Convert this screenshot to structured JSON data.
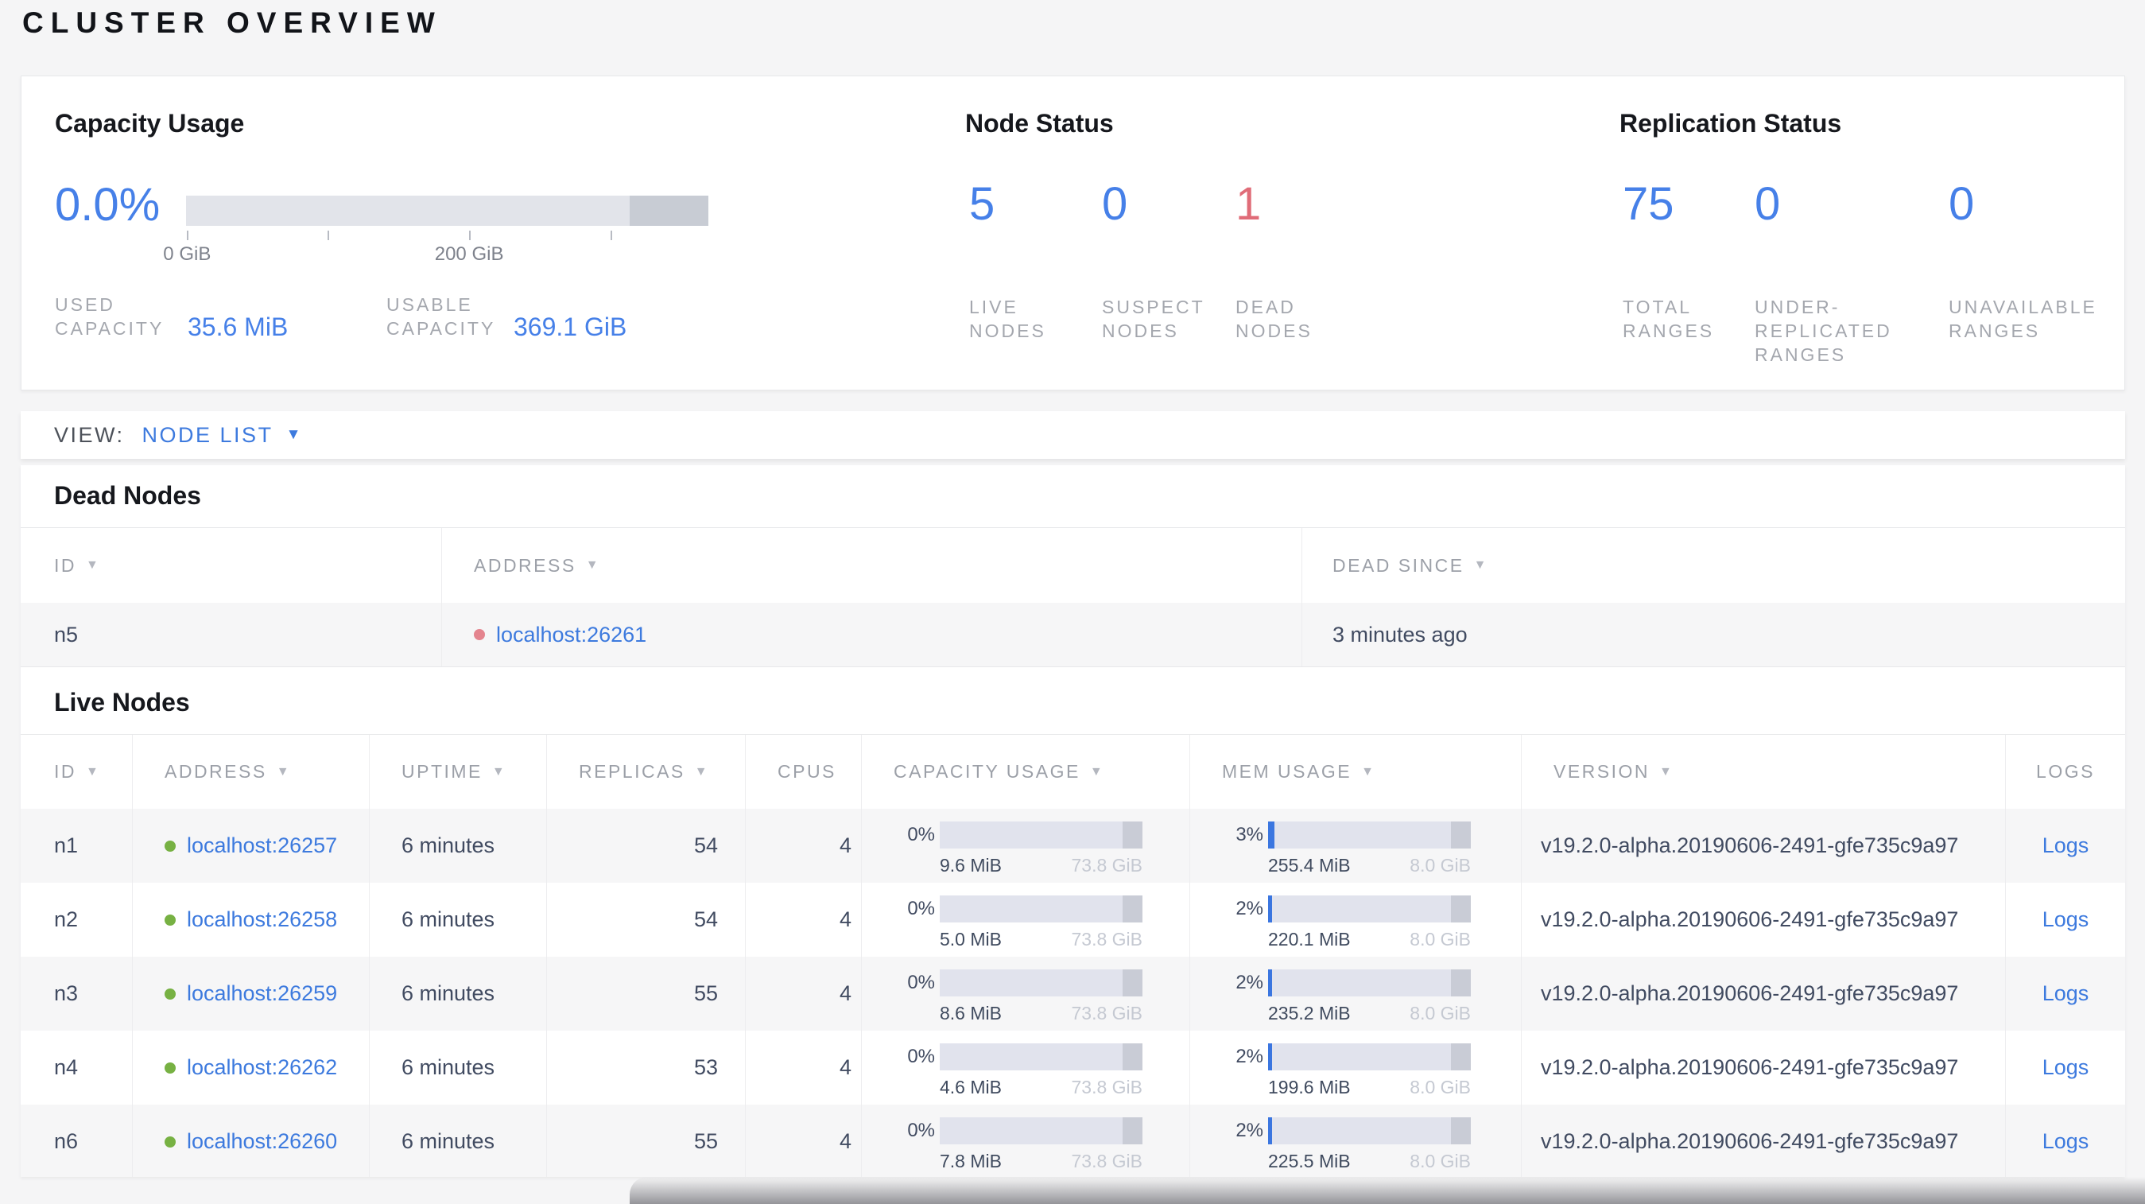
{
  "page": {
    "title": "CLUSTER OVERVIEW"
  },
  "icons": {
    "sort": "▼",
    "caret": "▼"
  },
  "colors": {
    "accent_blue": "#4680e8",
    "link_blue": "#3d7ade",
    "danger_red": "#e06c78",
    "live_dot_green": "#77b143",
    "dead_dot_red": "#e4848e",
    "bar_track": "#e2e4ea",
    "bar_dark_segment": "#c8ccd4",
    "mem_fill_blue": "#3b76e0"
  },
  "summary": {
    "capacity": {
      "title": "Capacity Usage",
      "percent": "0.0%",
      "ticks": [
        {
          "pos": 0.2,
          "label": "0 GiB"
        },
        {
          "pos": 27.1,
          "label": ""
        },
        {
          "pos": 54.2,
          "label": "200 GiB"
        },
        {
          "pos": 81.3,
          "label": ""
        }
      ],
      "stats": [
        {
          "label": "USED\nCAPACITY",
          "value": "35.6 MiB"
        },
        {
          "label": "USABLE\nCAPACITY",
          "value": "369.1 GiB"
        }
      ]
    },
    "node_status": {
      "title": "Node Status",
      "stats": [
        {
          "value": "5",
          "label": "LIVE\nNODES"
        },
        {
          "value": "0",
          "label": "SUSPECT\nNODES"
        },
        {
          "value": "1",
          "label": "DEAD\nNODES"
        }
      ]
    },
    "replication": {
      "title": "Replication Status",
      "stats": [
        {
          "value": "75",
          "label": "TOTAL\nRANGES"
        },
        {
          "value": "0",
          "label": "UNDER-\nREPLICATED\nRANGES"
        },
        {
          "value": "0",
          "label": "UNAVAILABLE\nRANGES"
        }
      ]
    }
  },
  "view_bar": {
    "label": "VIEW:",
    "selected": "NODE LIST"
  },
  "dead_nodes": {
    "title": "Dead Nodes",
    "columns": [
      {
        "label": "ID"
      },
      {
        "label": "ADDRESS"
      },
      {
        "label": "DEAD SINCE"
      }
    ],
    "rows": [
      {
        "id": "n5",
        "address": "localhost:26261",
        "dead_since": "3 minutes ago"
      }
    ]
  },
  "live_nodes": {
    "title": "Live Nodes",
    "columns": [
      {
        "label": "ID"
      },
      {
        "label": "ADDRESS"
      },
      {
        "label": "UPTIME"
      },
      {
        "label": "REPLICAS"
      },
      {
        "label": "CPUS"
      },
      {
        "label": "CAPACITY USAGE"
      },
      {
        "label": "MEM USAGE"
      },
      {
        "label": "VERSION"
      },
      {
        "label": "LOGS"
      }
    ],
    "rows": [
      {
        "id": "n1",
        "address": "localhost:26257",
        "uptime": "6 minutes",
        "replicas": "54",
        "cpus": "4",
        "capacity": {
          "percent": "0%",
          "fill_pct": 0,
          "used": "9.6 MiB",
          "total": "73.8 GiB"
        },
        "mem": {
          "percent": "3%",
          "fill_pct": 3,
          "used": "255.4 MiB",
          "total": "8.0 GiB"
        },
        "version": "v19.2.0-alpha.20190606-2491-gfe735c9a97",
        "logs_label": "Logs"
      },
      {
        "id": "n2",
        "address": "localhost:26258",
        "uptime": "6 minutes",
        "replicas": "54",
        "cpus": "4",
        "capacity": {
          "percent": "0%",
          "fill_pct": 0,
          "used": "5.0 MiB",
          "total": "73.8 GiB"
        },
        "mem": {
          "percent": "2%",
          "fill_pct": 2,
          "used": "220.1 MiB",
          "total": "8.0 GiB"
        },
        "version": "v19.2.0-alpha.20190606-2491-gfe735c9a97",
        "logs_label": "Logs"
      },
      {
        "id": "n3",
        "address": "localhost:26259",
        "uptime": "6 minutes",
        "replicas": "55",
        "cpus": "4",
        "capacity": {
          "percent": "0%",
          "fill_pct": 0,
          "used": "8.6 MiB",
          "total": "73.8 GiB"
        },
        "mem": {
          "percent": "2%",
          "fill_pct": 2,
          "used": "235.2 MiB",
          "total": "8.0 GiB"
        },
        "version": "v19.2.0-alpha.20190606-2491-gfe735c9a97",
        "logs_label": "Logs"
      },
      {
        "id": "n4",
        "address": "localhost:26262",
        "uptime": "6 minutes",
        "replicas": "53",
        "cpus": "4",
        "capacity": {
          "percent": "0%",
          "fill_pct": 0,
          "used": "4.6 MiB",
          "total": "73.8 GiB"
        },
        "mem": {
          "percent": "2%",
          "fill_pct": 2,
          "used": "199.6 MiB",
          "total": "8.0 GiB"
        },
        "version": "v19.2.0-alpha.20190606-2491-gfe735c9a97",
        "logs_label": "Logs"
      },
      {
        "id": "n6",
        "address": "localhost:26260",
        "uptime": "6 minutes",
        "replicas": "55",
        "cpus": "4",
        "capacity": {
          "percent": "0%",
          "fill_pct": 0,
          "used": "7.8 MiB",
          "total": "73.8 GiB"
        },
        "mem": {
          "percent": "2%",
          "fill_pct": 2,
          "used": "225.5 MiB",
          "total": "8.0 GiB"
        },
        "version": "v19.2.0-alpha.20190606-2491-gfe735c9a97",
        "logs_label": "Logs"
      }
    ]
  }
}
